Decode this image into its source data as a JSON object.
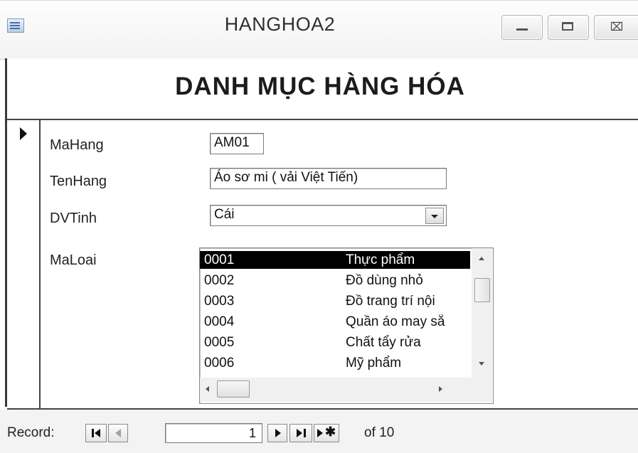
{
  "window": {
    "title": "HANGHOA2",
    "icon": "form-icon",
    "controls": [
      "minimize-icon",
      "maximize-icon",
      "close-icon"
    ],
    "close_glyph": "⌧"
  },
  "form": {
    "heading": "DANH MỤC HÀNG HÓA",
    "fields": {
      "mahang": {
        "label": "MaHang",
        "value": "AM01"
      },
      "tenhang": {
        "label": "TenHang",
        "value": "Áo sơ mi ( vải Việt Tiến)"
      },
      "dvtinh": {
        "label": "DVTinh",
        "value": "Cái"
      },
      "maloai": {
        "label": "MaLoai"
      }
    },
    "maloai_list": {
      "rows": [
        {
          "code": "0001",
          "name": "Thực phẩm",
          "selected": true
        },
        {
          "code": "0002",
          "name": "Đồ dùng nhỏ"
        },
        {
          "code": "0003",
          "name": "Đồ trang trí nội"
        },
        {
          "code": "0004",
          "name": "Quần áo may sẵ"
        },
        {
          "code": "0005",
          "name": "Chất tẩy rửa"
        },
        {
          "code": "0006",
          "name": "Mỹ phẩm"
        }
      ]
    }
  },
  "navigation": {
    "label": "Record:",
    "current": "1",
    "of_text": "of 10",
    "buttons": [
      "first-record-icon",
      "previous-record-icon",
      "next-record-icon",
      "last-record-icon",
      "new-record-icon"
    ]
  }
}
